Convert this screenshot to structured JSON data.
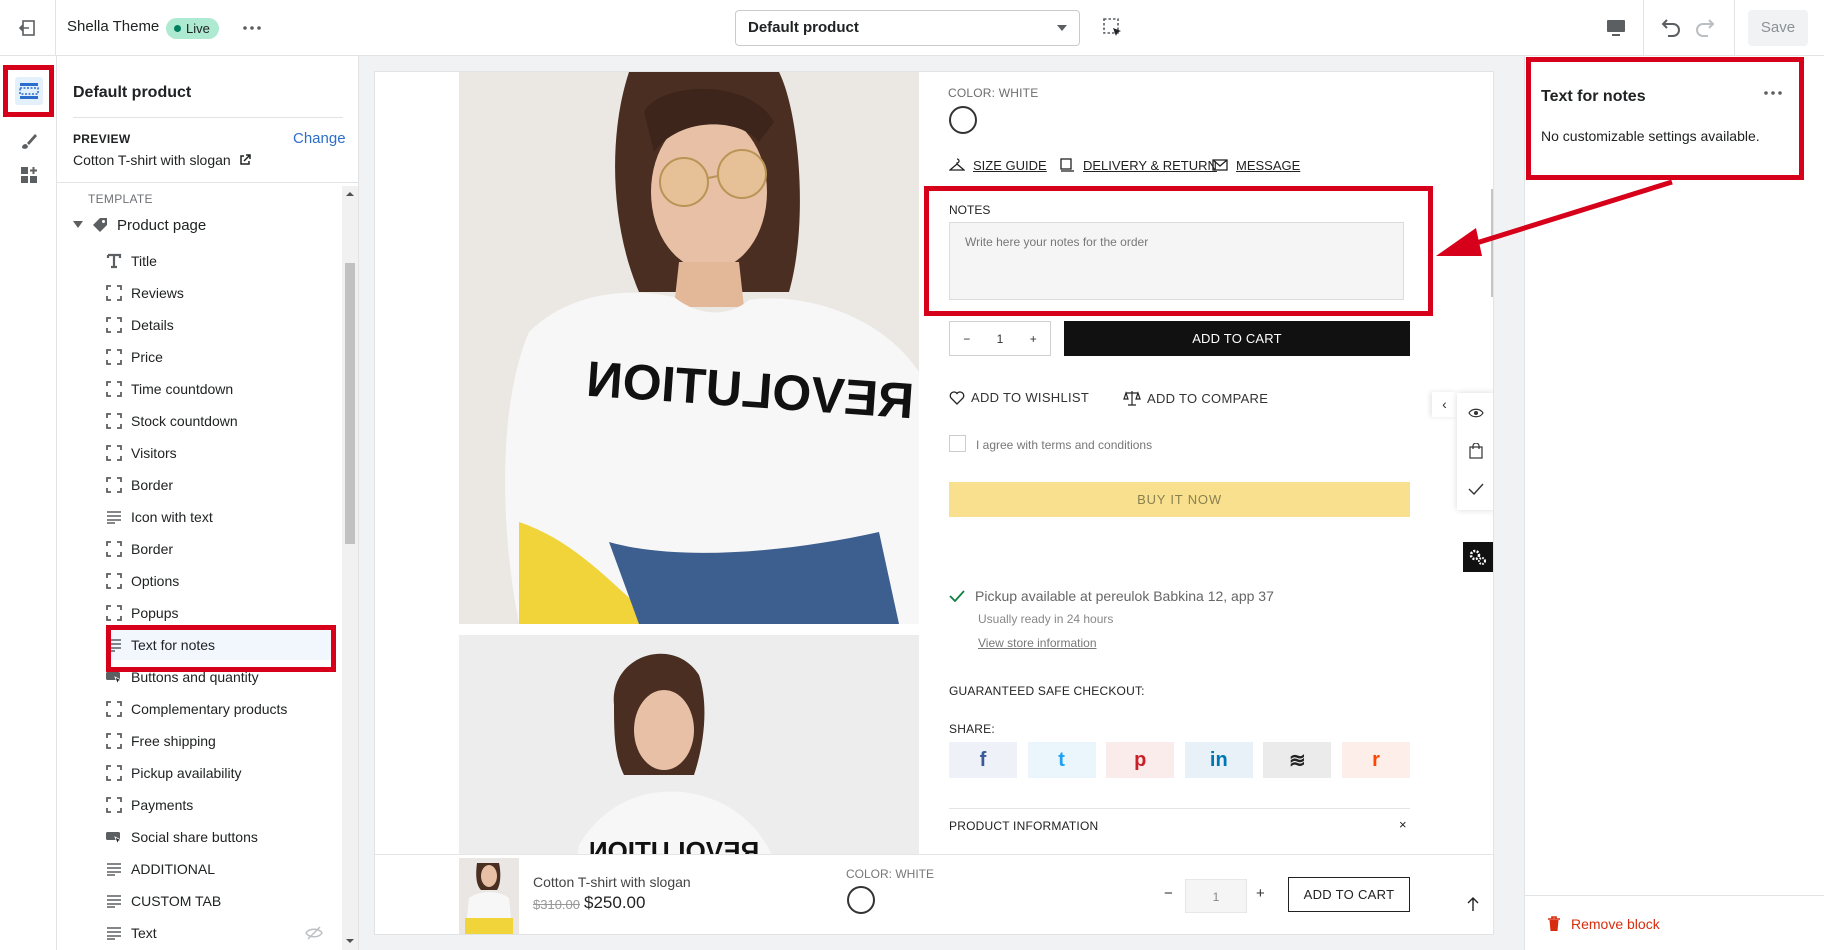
{
  "topbar": {
    "theme_name": "Shella Theme",
    "live_badge": "Live",
    "template_select": "Default product",
    "save_label": "Save"
  },
  "sidebar": {
    "title": "Default product",
    "preview_label": "PREVIEW",
    "change_label": "Change",
    "preview_value": "Cotton T-shirt with slogan",
    "template_label": "TEMPLATE",
    "product_page": "Product page",
    "items": [
      {
        "label": "Title",
        "icon": "text-icon"
      },
      {
        "label": "Reviews",
        "icon": "block-icon"
      },
      {
        "label": "Details",
        "icon": "block-icon"
      },
      {
        "label": "Price",
        "icon": "block-icon"
      },
      {
        "label": "Time countdown",
        "icon": "block-icon"
      },
      {
        "label": "Stock countdown",
        "icon": "block-icon"
      },
      {
        "label": "Visitors",
        "icon": "block-icon"
      },
      {
        "label": "Border",
        "icon": "block-icon"
      },
      {
        "label": "Icon with text",
        "icon": "lines-icon"
      },
      {
        "label": "Border",
        "icon": "block-icon"
      },
      {
        "label": "Options",
        "icon": "block-icon"
      },
      {
        "label": "Popups",
        "icon": "block-icon"
      },
      {
        "label": "Text for notes",
        "icon": "lines-icon"
      },
      {
        "label": "Buttons and quantity",
        "icon": "buy-button-icon"
      },
      {
        "label": "Complementary products",
        "icon": "block-icon"
      },
      {
        "label": "Free shipping",
        "icon": "block-icon"
      },
      {
        "label": "Pickup availability",
        "icon": "block-icon"
      },
      {
        "label": "Payments",
        "icon": "block-icon"
      },
      {
        "label": "Social share buttons",
        "icon": "buy-button-icon"
      },
      {
        "label": "ADDITIONAL",
        "icon": "lines-icon"
      },
      {
        "label": "CUSTOM TAB",
        "icon": "lines-icon"
      },
      {
        "label": "Text",
        "icon": "lines-icon"
      }
    ]
  },
  "product": {
    "color_label": "COLOR: ",
    "color_value": "WHITE",
    "size_guide": "SIZE GUIDE",
    "delivery_return": "DELIVERY & RETURN",
    "message": "MESSAGE",
    "notes_label": "NOTES",
    "notes_placeholder": "Write here your notes for the order",
    "qty_minus": "−",
    "qty_value": "1",
    "qty_plus": "+",
    "add_to_cart": "ADD TO CART",
    "add_to_wishlist": "ADD TO WISHLIST",
    "add_to_compare": "ADD TO COMPARE",
    "terms": "I agree with terms and conditions",
    "buy_now": "BUY IT NOW",
    "pickup": "Pickup available at pereulok Babkina 12, app 37",
    "pickup_ready": "Usually ready in 24 hours",
    "pickup_link": "View store information",
    "guaranteed": "GUARANTEED SAFE CHECKOUT:",
    "share_label": "SHARE:",
    "share_buttons": [
      {
        "glyph": "f",
        "icon": "facebook-icon",
        "bg": "#eef2f8",
        "color": "#3b5998"
      },
      {
        "glyph": "t",
        "icon": "twitter-icon",
        "bg": "#eaf5fc",
        "color": "#1da1f2"
      },
      {
        "glyph": "p",
        "icon": "pinterest-icon",
        "bg": "#fbecec",
        "color": "#cb2027"
      },
      {
        "glyph": "in",
        "icon": "linkedin-icon",
        "bg": "#e8f1f7",
        "color": "#0077b5"
      },
      {
        "glyph": "≋",
        "icon": "buffer-icon",
        "bg": "#ebebeb",
        "color": "#222222"
      },
      {
        "glyph": "r",
        "icon": "reddit-icon",
        "bg": "#fdeee9",
        "color": "#ff4500"
      }
    ],
    "product_information": "PRODUCT INFORMATION",
    "product_information_close": "×",
    "tshirt_print": "REVOLUTION"
  },
  "sticky": {
    "name": "Cotton T-shirt with slogan",
    "old_price": "$310.00",
    "new_price": "$250.00",
    "color_label": "COLOR: ",
    "color_value": "WHITE",
    "minus": "−",
    "qty": "1",
    "plus": "+",
    "add_to_cart": "ADD TO CART"
  },
  "inspector": {
    "title": "Text for notes",
    "description": "No customizable settings available.",
    "remove_block": "Remove block"
  },
  "colors": {
    "highlight": "#d7001a",
    "shopify_blue": "#2c6ecb",
    "buy_now_bg": "#f8e08e",
    "remove_red": "#d72c0d"
  }
}
